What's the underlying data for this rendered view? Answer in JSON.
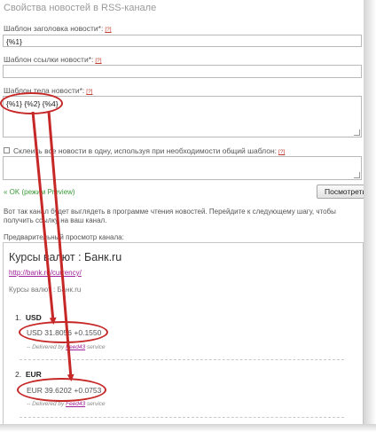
{
  "section_title": "Свойства новостей в RSS-канале",
  "help_mark": "[?]",
  "title_template": {
    "label": "Шаблон заголовка новости*:",
    "value": "{%1}"
  },
  "link_template": {
    "label": "Шаблон ссылки новости*:",
    "value": ""
  },
  "body_template": {
    "label": "Шаблон тела новости*:",
    "value": "{%1} {%2} {%4}"
  },
  "merge_option": {
    "label": "Склеить все новости в одну, используя при необходимости общий шаблон:",
    "checked": false,
    "value": ""
  },
  "status": "« OK (режим Preview)",
  "preview_button": "Посмотреть",
  "description": "Вот так канал будет выглядеть в программе чтения новостей. Перейдите к следующему шагу, чтобы получить ссылку на ваш канал.",
  "preview_label": "Предварительный просмотр канала:",
  "preview": {
    "channel_title": "Курсы валют : Банк.ru",
    "channel_link": "http://bank.ru/currency/",
    "channel_desc": "Курсы валют : Банк.ru",
    "items": [
      {
        "number": "1.",
        "title": "USD",
        "body": "USD 31.8056 +0.1550",
        "delivered_prefix": "-- Delivered by",
        "delivered_link": "Feed43",
        "delivered_suffix": "service"
      },
      {
        "number": "2.",
        "title": "EUR",
        "body": "EUR 39.6202 +0.0753",
        "delivered_prefix": "-- Delivered by",
        "delivered_link": "Feed43",
        "delivered_suffix": "service"
      }
    ]
  },
  "colors": {
    "annotation": "#c62828",
    "ok_status": "#3a9a3a",
    "link": "#a0229a"
  }
}
